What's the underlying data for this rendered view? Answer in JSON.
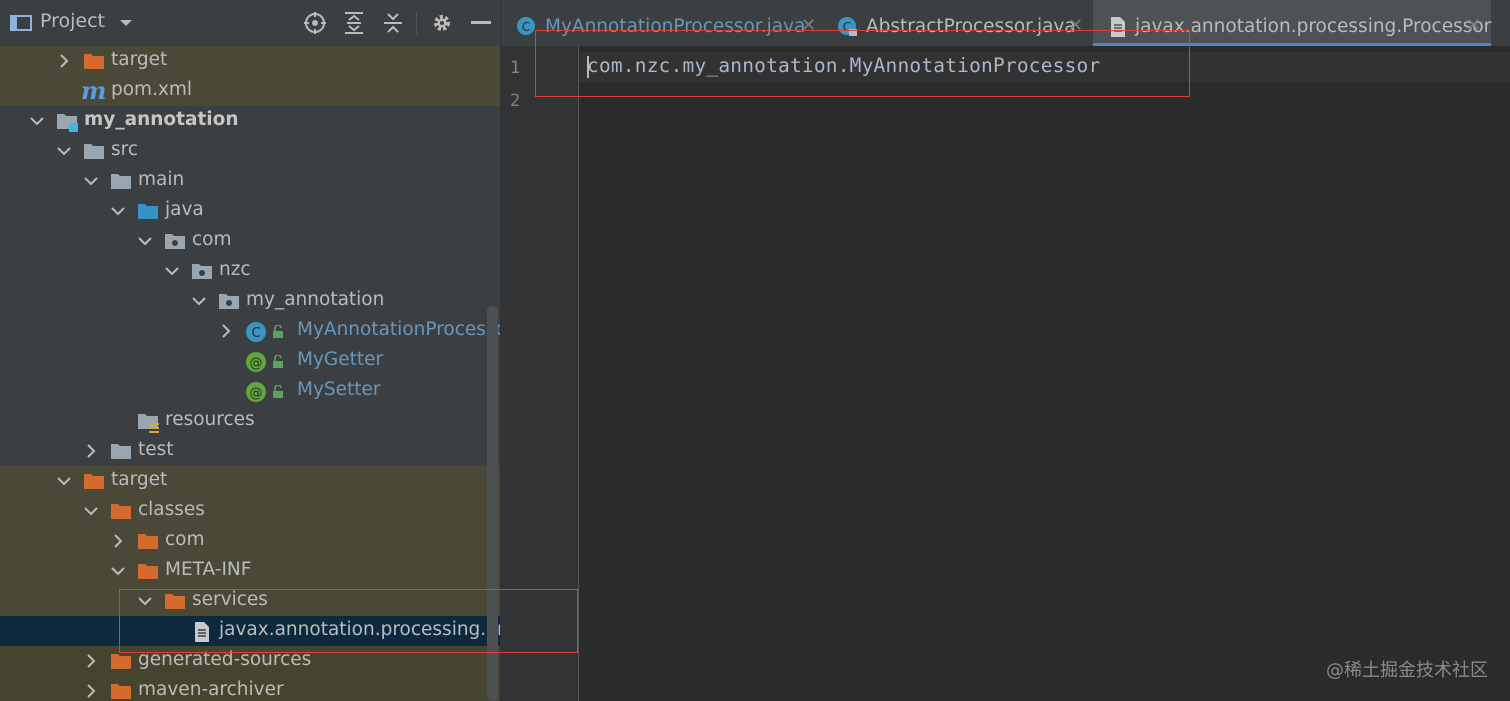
{
  "project_panel": {
    "title": "Project",
    "tree": [
      {
        "label": "target",
        "icon": "folder-orange-icon",
        "expand": "collapsed"
      },
      {
        "label": "pom.xml",
        "icon": "maven-icon",
        "expand": "none"
      },
      {
        "label": "my_annotation",
        "icon": "module-folder-icon",
        "expand": "expanded"
      },
      {
        "label": "src",
        "icon": "folder-gray-icon",
        "expand": "expanded"
      },
      {
        "label": "main",
        "icon": "folder-gray-icon",
        "expand": "expanded"
      },
      {
        "label": "java",
        "icon": "folder-blue-icon",
        "expand": "expanded"
      },
      {
        "label": "com",
        "icon": "package-icon",
        "expand": "expanded"
      },
      {
        "label": "nzc",
        "icon": "package-icon",
        "expand": "expanded"
      },
      {
        "label": "my_annotation",
        "icon": "package-icon",
        "expand": "expanded"
      },
      {
        "label": "MyAnnotationProcessor",
        "icon": "class-icon",
        "expand": "collapsed"
      },
      {
        "label": "MyGetter",
        "icon": "annotation-icon",
        "expand": "none"
      },
      {
        "label": "MySetter",
        "icon": "annotation-icon",
        "expand": "none"
      },
      {
        "label": "resources",
        "icon": "resources-folder-icon",
        "expand": "none"
      },
      {
        "label": "test",
        "icon": "folder-gray-icon",
        "expand": "collapsed"
      },
      {
        "label": "target",
        "icon": "folder-orange-icon",
        "expand": "expanded"
      },
      {
        "label": "classes",
        "icon": "folder-orange-icon",
        "expand": "expanded"
      },
      {
        "label": "com",
        "icon": "folder-orange-icon",
        "expand": "collapsed"
      },
      {
        "label": "META-INF",
        "icon": "folder-orange-icon",
        "expand": "expanded"
      },
      {
        "label": "services",
        "icon": "folder-orange-icon",
        "expand": "expanded"
      },
      {
        "label": "javax.annotation.processing.Proc",
        "icon": "text-file-icon",
        "expand": "none"
      },
      {
        "label": "generated-sources",
        "icon": "folder-orange-icon",
        "expand": "collapsed"
      },
      {
        "label": "maven-archiver",
        "icon": "folder-orange-icon",
        "expand": "collapsed"
      }
    ]
  },
  "editor": {
    "tabs": [
      {
        "label": "MyAnnotationProcessor.java",
        "icon": "class-icon",
        "active": false
      },
      {
        "label": "AbstractProcessor.java",
        "icon": "class-locked-icon",
        "active": false
      },
      {
        "label": "javax.annotation.processing.Processor",
        "icon": "text-file-icon",
        "active": true
      }
    ],
    "line_numbers": [
      "1",
      "2"
    ],
    "code_lines": [
      "com.nzc.my_annotation.MyAnnotationProcessor"
    ]
  },
  "watermark": "@稀土掘金技术社区",
  "colors": {
    "panel_bg": "#3c3f41",
    "editor_bg": "#2b2b2b",
    "highlight_row": "#4a4836",
    "selected_row": "#0d293e",
    "annotation_red": "#d9413b",
    "tab_underline": "#4a88c7"
  }
}
